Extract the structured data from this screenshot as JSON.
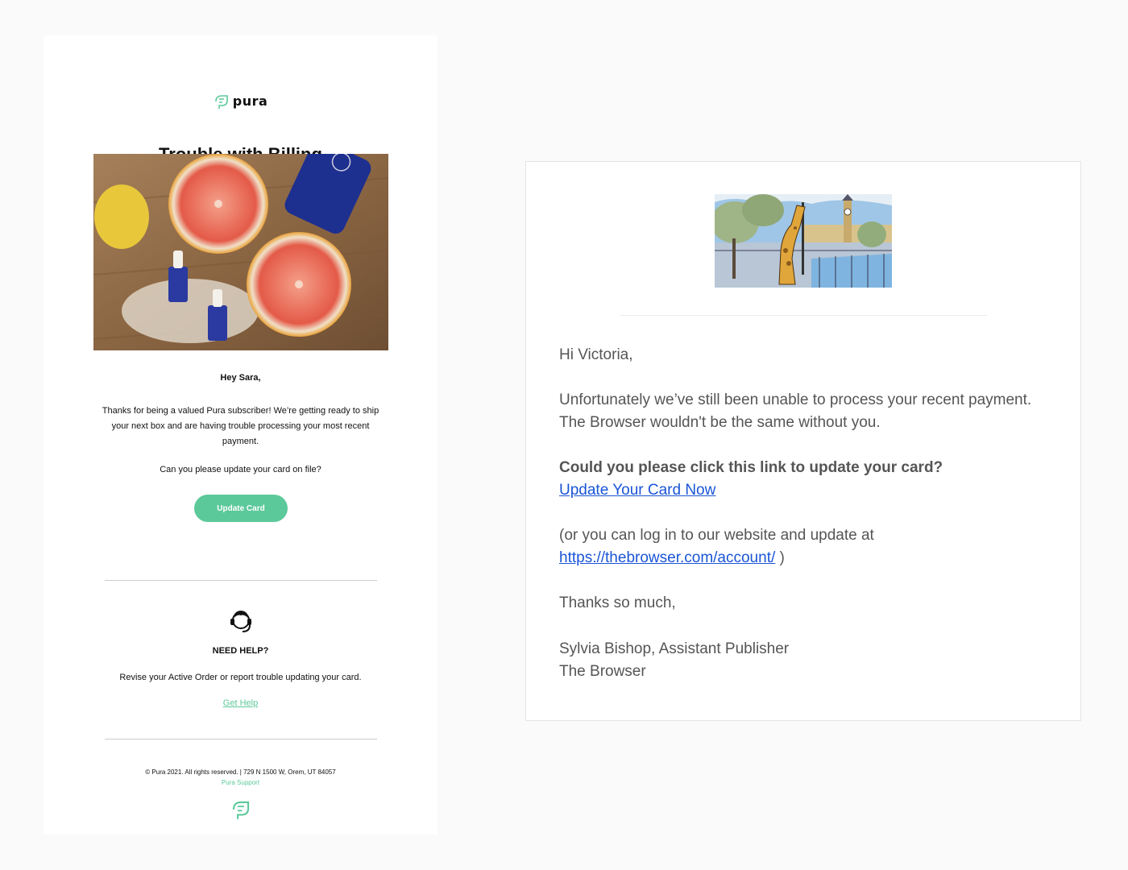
{
  "pura": {
    "logo_text": "pura",
    "title": "Trouble with Billing",
    "greeting": "Hey Sara,",
    "body": "Thanks for being a valued Pura subscriber! We’re getting ready to ship your next box and are having trouble processing your most recent payment.",
    "question": "Can you please update your card on file?",
    "button_label": "Update Card",
    "help_title": "NEED HELP?",
    "help_text": "Revise your Active Order or report trouble updating your card.",
    "help_link": "Get Help",
    "footer": "© Pura 2021. All rights reserved. | 729 N 1500 W, Orem, UT 84057",
    "support_link": "Pura Support",
    "brand_color": "#5cc99a"
  },
  "browser": {
    "greeting": "Hi Victoria,",
    "line1": "Unfortunately we’ve still been unable to process your recent payment.",
    "line2": "The Browser wouldn't be the same without you.",
    "question": "Could you please click this link to update your card?",
    "link": "Update Your Card Now",
    "alt_prefix": "(or you can log in to our website and update at",
    "alt_url": "https://thebrowser.com/account/",
    "alt_suffix": " )",
    "thanks": "Thanks so much,",
    "signature_name": "Sylvia Bishop, Assistant Publisher",
    "signature_org": "The Browser",
    "link_color": "#1a55d6"
  }
}
